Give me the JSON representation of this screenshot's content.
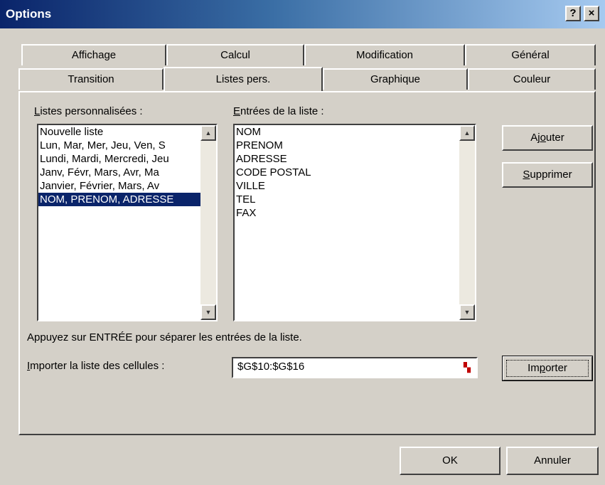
{
  "window": {
    "title": "Options",
    "help_label": "?",
    "close_label": "×"
  },
  "tabs": {
    "row_back": [
      "Affichage",
      "Calcul",
      "Modification",
      "Général"
    ],
    "row_front": [
      "Transition",
      "Listes pers.",
      "Graphique",
      "Couleur"
    ],
    "active": "Listes pers."
  },
  "custom_lists": {
    "label_accel": "L",
    "label_rest": "istes personnalisées :",
    "items": [
      "Nouvelle liste",
      "Lun, Mar, Mer, Jeu, Ven, S",
      "Lundi, Mardi, Mercredi, Jeu",
      "Janv, Févr, Mars, Avr, Ma",
      "Janvier, Février, Mars, Av",
      "NOM, PRENOM, ADRESSE"
    ],
    "selected_index": 5
  },
  "entries": {
    "label_accel": "E",
    "label_rest": "ntrées de la liste :",
    "items": [
      "NOM",
      "PRENOM",
      "ADRESSE",
      "CODE POSTAL",
      "VILLE",
      "TEL",
      "FAX"
    ]
  },
  "buttons": {
    "add_pre": "Aj",
    "add_accel": "o",
    "add_post": "uter",
    "delete_accel": "S",
    "delete_rest": "upprimer",
    "import_pre": "Im",
    "import_accel": "p",
    "import_post": "orter",
    "ok": "OK",
    "cancel": "Annuler"
  },
  "hint": "Appuyez sur ENTRÉE pour séparer les entrées de la liste.",
  "import_range": {
    "label_accel": "I",
    "label_rest": "mporter la liste des cellules :",
    "value": "$G$10:$G$16"
  },
  "icons": {
    "collapse_dialog": "range-collapse-icon",
    "scroll_up": "arrow-up-icon",
    "scroll_down": "arrow-down-icon"
  },
  "colors": {
    "title_gradient_start": "#0a246a",
    "title_gradient_end": "#a6caf0",
    "dialog_face": "#d4d0c8",
    "selection": "#0a246a"
  }
}
